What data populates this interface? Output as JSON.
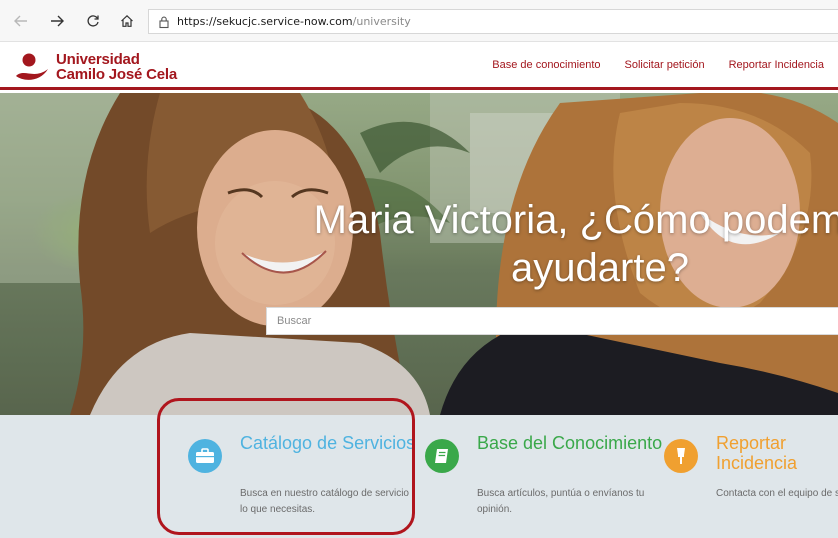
{
  "browser": {
    "url_host": "https://sekucjc.service-now.com",
    "url_path": "/university"
  },
  "header": {
    "logo_line1": "Universidad",
    "logo_line2": "Camilo José Cela",
    "nav": [
      {
        "label": "Base de conocimiento"
      },
      {
        "label": "Solicitar petición"
      },
      {
        "label": "Reportar Incidencia"
      }
    ]
  },
  "hero": {
    "greeting": "Maria Victoria, ¿Cómo podemos ayudarte?",
    "search_placeholder": "Buscar"
  },
  "cards": [
    {
      "title": "Catálogo de Servicios",
      "description": "Busca en nuestro catálogo de servicio lo que necesitas.",
      "color": "#4fb3e0",
      "icon": "briefcase-icon"
    },
    {
      "title": "Base del Conocimiento",
      "description": "Busca artículos, puntúa o envíanos tu opinión.",
      "color": "#3aa84a",
      "icon": "book-icon"
    },
    {
      "title": "Reportar Incidencia",
      "description": "Contacta con el equipo de soporte para reportar una",
      "color": "#f0a030",
      "icon": "alert-icon"
    }
  ],
  "colors": {
    "brand": "#a3171e",
    "highlight": "#b0151d"
  }
}
